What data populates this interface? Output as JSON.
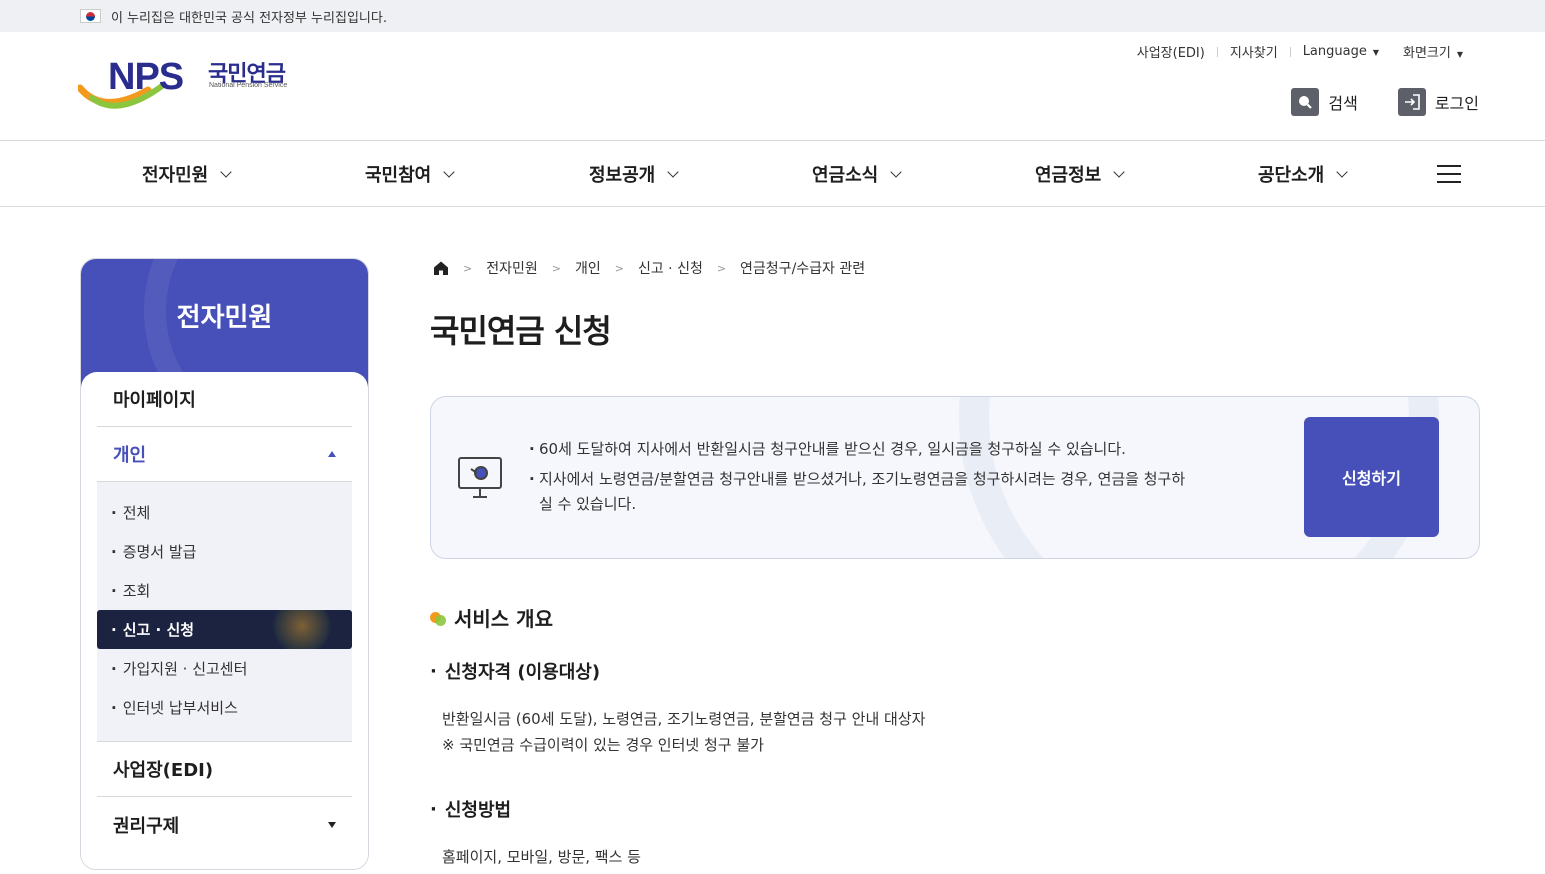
{
  "gov_banner": {
    "text": "이 누리집은 대한민국 공식 전자정부 누리집입니다."
  },
  "logo": {
    "abbr": "NPS",
    "kr": "국민연금",
    "en": "National Pension Service"
  },
  "util_links": [
    "사업장(EDI)",
    "지사찾기",
    "Language",
    "화면크기"
  ],
  "header_actions": {
    "search": "검색",
    "login": "로그인"
  },
  "gnb": [
    "전자민원",
    "국민참여",
    "정보공개",
    "연금소식",
    "연금정보",
    "공단소개"
  ],
  "sidebar": {
    "title": "전자민원",
    "l1": {
      "mypage": "마이페이지",
      "personal": "개인",
      "edi": "사업장(EDI)",
      "rights": "권리구제"
    },
    "sub": [
      "전체",
      "증명서 발급",
      "조회",
      "신고 · 신청",
      "가입지원 · 신고센터",
      "인터넷 납부서비스"
    ]
  },
  "breadcrumb": [
    "전자민원",
    "개인",
    "신고 · 신청",
    "연금청구/수급자 관련"
  ],
  "page_title": "국민연금 신청",
  "notice": {
    "items": [
      "60세 도달하여 지사에서 반환일시금 청구안내를 받으신 경우, 일시금을 청구하실 수 있습니다.",
      "지사에서 노령연금/분할연금 청구안내를 받으셨거나, 조기노령연금을 청구하시려는 경우, 연금을 청구하실 수 있습니다."
    ],
    "apply_button": "신청하기"
  },
  "overview": {
    "heading": "서비스 개요",
    "eligibility_title": "신청자격 (이용대상)",
    "eligibility_line1": "반환일시금 (60세 도달), 노령연금, 조기노령연금, 분할연금 청구 안내 대상자",
    "eligibility_line2": "※ 국민연금 수급이력이 있는 경우 인터넷 청구 불가",
    "method_title": "신청방법",
    "method_text": "홈페이지, 모바일, 방문, 팩스 등"
  },
  "colors": {
    "brand": "#4650b8",
    "active_sub": "#1c2340",
    "logo_navy": "#2a2c8e"
  }
}
